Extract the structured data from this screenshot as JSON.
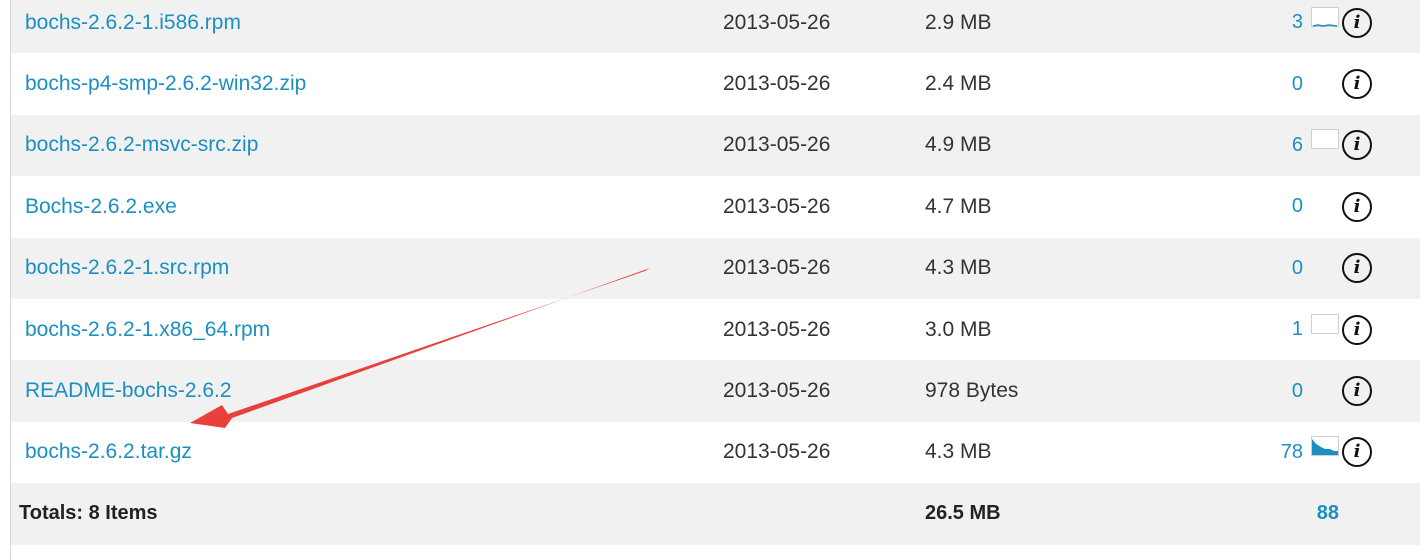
{
  "files": [
    {
      "name": "bochs-2.6.2-1.i586.rpm",
      "date": "2013-05-26",
      "size": "2.9 MB",
      "downloads": "3",
      "sparkline": "tiny-activity"
    },
    {
      "name": "bochs-p4-smp-2.6.2-win32.zip",
      "date": "2013-05-26",
      "size": "2.4 MB",
      "downloads": "0",
      "sparkline": "none"
    },
    {
      "name": "bochs-2.6.2-msvc-src.zip",
      "date": "2013-05-26",
      "size": "4.9 MB",
      "downloads": "6",
      "sparkline": "empty-box"
    },
    {
      "name": "Bochs-2.6.2.exe",
      "date": "2013-05-26",
      "size": "4.7 MB",
      "downloads": "0",
      "sparkline": "none"
    },
    {
      "name": "bochs-2.6.2-1.src.rpm",
      "date": "2013-05-26",
      "size": "4.3 MB",
      "downloads": "0",
      "sparkline": "none"
    },
    {
      "name": "bochs-2.6.2-1.x86_64.rpm",
      "date": "2013-05-26",
      "size": "3.0 MB",
      "downloads": "1",
      "sparkline": "empty-box"
    },
    {
      "name": "README-bochs-2.6.2",
      "date": "2013-05-26",
      "size": "978 Bytes",
      "downloads": "0",
      "sparkline": "none"
    },
    {
      "name": "bochs-2.6.2.tar.gz",
      "date": "2013-05-26",
      "size": "4.3 MB",
      "downloads": "78",
      "sparkline": "filled-area"
    }
  ],
  "totals": {
    "label": "Totals: 8 Items",
    "size": "26.5 MB",
    "downloads": "88"
  },
  "icons": {
    "info": "info-icon"
  },
  "colors": {
    "link": "#1b8fc2",
    "row_alt": "#f1f1f1",
    "arrow": "#e8403a"
  },
  "annotation": {
    "type": "arrow",
    "points_to": "bochs-2.6.2.tar.gz"
  }
}
